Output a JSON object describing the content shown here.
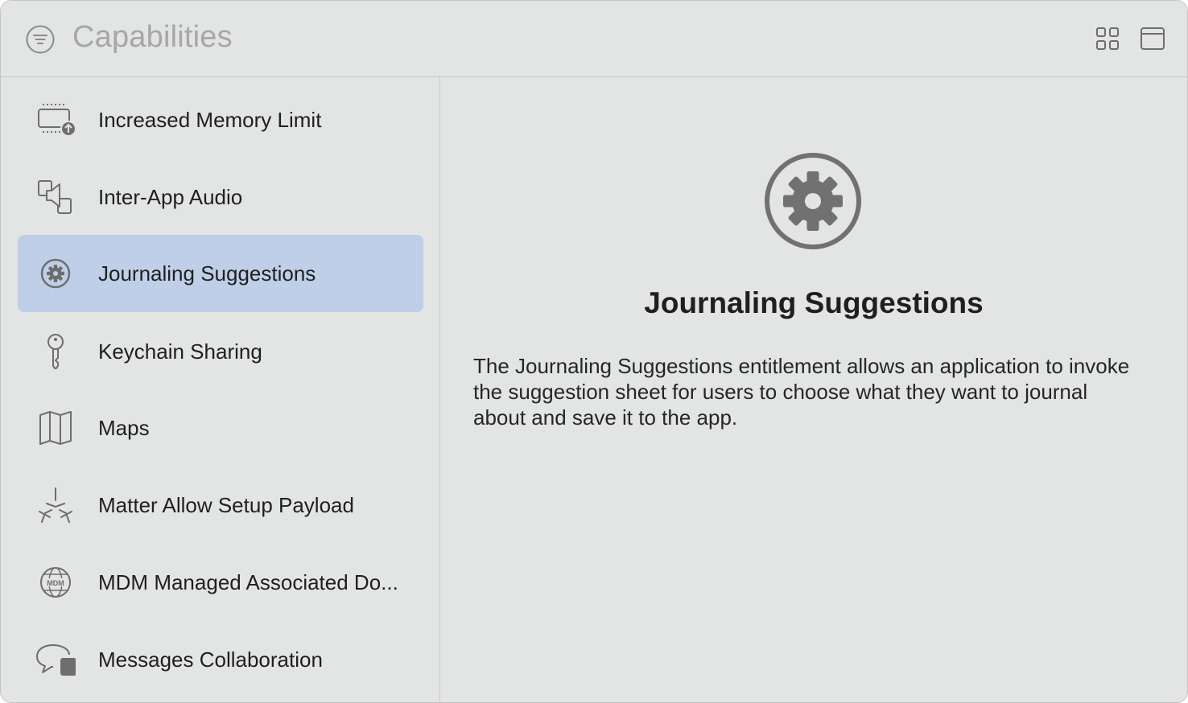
{
  "header": {
    "title": "Capabilities",
    "filter_icon": "filter-icon",
    "grid_icon": "grid-view-icon",
    "window_icon": "window-icon"
  },
  "sidebar": {
    "selected_index": 2,
    "selection_color": "#bfcfe8",
    "items": [
      {
        "label": "Increased Memory Limit",
        "icon": "memory-upload-icon"
      },
      {
        "label": "Inter-App Audio",
        "icon": "inter-app-audio-icon"
      },
      {
        "label": "Journaling Suggestions",
        "icon": "gear-icon"
      },
      {
        "label": "Keychain Sharing",
        "icon": "key-icon"
      },
      {
        "label": "Maps",
        "icon": "map-icon"
      },
      {
        "label": "Matter Allow Setup Payload",
        "icon": "matter-icon"
      },
      {
        "label": "MDM Managed Associated Do...",
        "icon": "mdm-globe-icon",
        "icon_text": "MDM"
      },
      {
        "label": "Messages Collaboration",
        "icon": "messages-collaboration-icon"
      }
    ]
  },
  "detail": {
    "icon": "gear-icon",
    "title": "Journaling Suggestions",
    "description": "The Journaling Suggestions entitlement allows an application to invoke the suggestion sheet for users to choose what they want to journal about and save it to the app."
  }
}
